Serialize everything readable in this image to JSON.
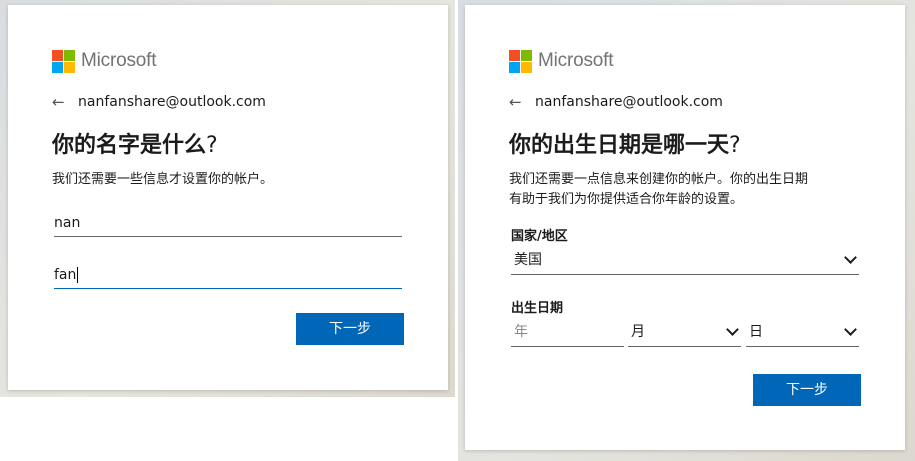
{
  "left_card": {
    "brand": "Microsoft",
    "email": "nanfanshare@outlook.com",
    "title": "你的名字是什么",
    "title_mark": "?",
    "description": "我们还需要一些信息才设置你的帐户。",
    "first_name_value": "nan",
    "last_name_value": "fan",
    "next_button": "下一步"
  },
  "right_card": {
    "brand": "Microsoft",
    "email": "nanfanshare@outlook.com",
    "title": "你的出生日期是哪一天",
    "title_mark": "?",
    "description_line1": "我们还需要一点信息来创建你的帐户。你的出生日期",
    "description_line2": "有助于我们为你提供适合你年龄的设置。",
    "country_label": "国家/地区",
    "country_value": "美国",
    "birthdate_label": "出生日期",
    "year_placeholder": "年",
    "month_value": "月",
    "day_value": "日",
    "next_button": "下一步"
  },
  "colors": {
    "accent": "#0067b8",
    "logo_red": "#f25022",
    "logo_green": "#7fba00",
    "logo_blue": "#00a4ef",
    "logo_yellow": "#ffb900"
  },
  "icons": {
    "back": "left-arrow-icon",
    "dropdown": "chevron-down-icon"
  }
}
